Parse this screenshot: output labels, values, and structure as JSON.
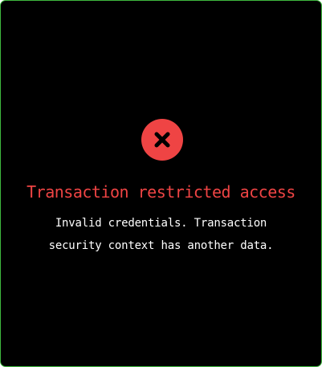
{
  "colors": {
    "background": "#000000",
    "border": "#3fb83f",
    "accent_red": "#ef4444",
    "text": "#ffffff",
    "icon_glyph": "#000000"
  },
  "dialog": {
    "icon": "close-x-icon",
    "title": "Transaction restricted access",
    "message_lines": [
      "Invalid credentials. Transaction",
      "security context has another data."
    ]
  }
}
